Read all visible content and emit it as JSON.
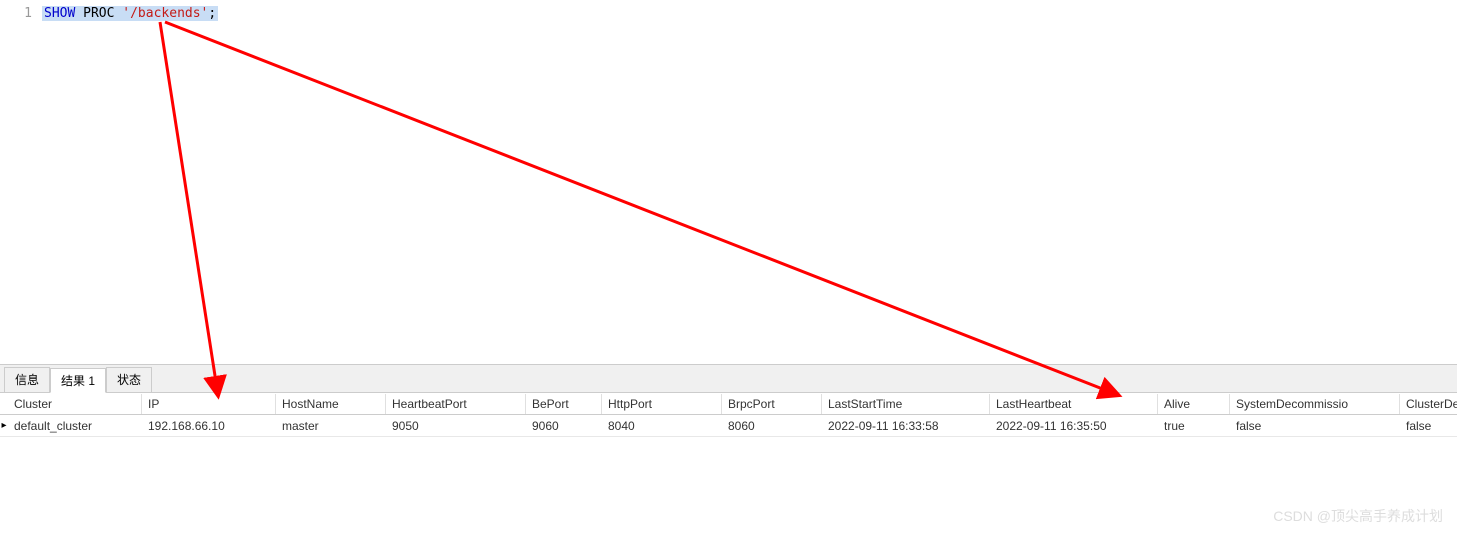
{
  "editor": {
    "line_number": "1",
    "tokens": {
      "show": "SHOW",
      "proc": " PROC ",
      "str": "'/backends'",
      "semi": ";"
    }
  },
  "tabs": {
    "info": "信息",
    "result1": "结果 1",
    "status": "状态"
  },
  "grid": {
    "headers": {
      "cluster": "Cluster",
      "ip": "IP",
      "hostname": "HostName",
      "hbport": "HeartbeatPort",
      "beport": "BePort",
      "httpport": "HttpPort",
      "brpcport": "BrpcPort",
      "laststart": "LastStartTime",
      "lasthb": "LastHeartbeat",
      "alive": "Alive",
      "sysdecom": "SystemDecommissio",
      "clsdecom": "ClusterDecommissio"
    },
    "row": {
      "indicator": "▸",
      "cluster": "default_cluster",
      "ip": "192.168.66.10",
      "hostname": "master",
      "hbport": "9050",
      "beport": "9060",
      "httpport": "8040",
      "brpcport": "8060",
      "laststart": "2022-09-11 16:33:58",
      "lasthb": "2022-09-11 16:35:50",
      "alive": "true",
      "sysdecom": "false",
      "clsdecom": "false"
    }
  },
  "watermark": "CSDN @顶尖高手养成计划"
}
